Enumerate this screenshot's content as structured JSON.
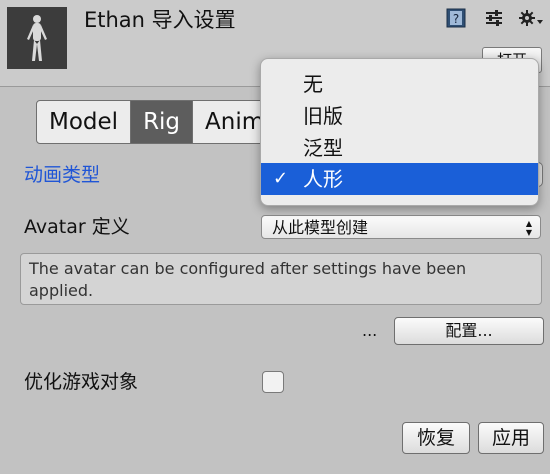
{
  "header": {
    "title": "Ethan 导入设置",
    "open_button": "打开"
  },
  "tabs": [
    {
      "label": "Model",
      "active": false
    },
    {
      "label": "Rig",
      "active": true
    },
    {
      "label": "Animation",
      "active": false
    }
  ],
  "animation_type": {
    "label": "动画类型"
  },
  "avatar_definition": {
    "label": "Avatar 定义",
    "value": "从此模型创建"
  },
  "help_text": "The avatar can be configured after settings have been applied.",
  "configure": {
    "ellipsis": "...",
    "button": "配置..."
  },
  "optimize": {
    "label": "优化游戏对象",
    "checked": false
  },
  "footer": {
    "revert": "恢复",
    "apply": "应用"
  },
  "dropdown": {
    "options": [
      {
        "label": "无"
      },
      {
        "label": "旧版"
      },
      {
        "label": "泛型"
      },
      {
        "label": "人形",
        "selected": true
      }
    ],
    "checkmark": "✓"
  },
  "colors": {
    "accent_blue": "#1f55d6",
    "selection_blue": "#1a5fd8"
  }
}
